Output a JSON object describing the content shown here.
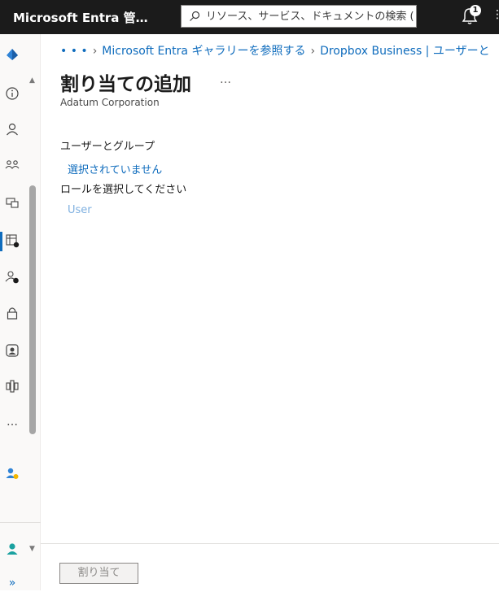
{
  "header": {
    "app_title": "Microsoft Entra 管…",
    "search_placeholder": "リソース、サービス、ドキュメントの検索 (G+/)",
    "notification_count": "1"
  },
  "breadcrumb": {
    "ellipsis": "• • •",
    "items": [
      "Microsoft Entra ギャラリーを参照する",
      "Dropbox Business | ユーザーと"
    ]
  },
  "page": {
    "title": "割り当ての追加",
    "more": "…",
    "subtitle": "Adatum Corporation"
  },
  "form": {
    "users_groups_label": "ユーザーとグループ",
    "users_groups_value": "選択されていません",
    "role_label": "ロールを選択してください",
    "role_value": "User"
  },
  "footer": {
    "assign_label": "割り当て"
  },
  "leftnav": {
    "more": "…",
    "expand": "»"
  },
  "colors": {
    "accent": "#0f6cbd",
    "topbar": "#1b1b1b"
  }
}
